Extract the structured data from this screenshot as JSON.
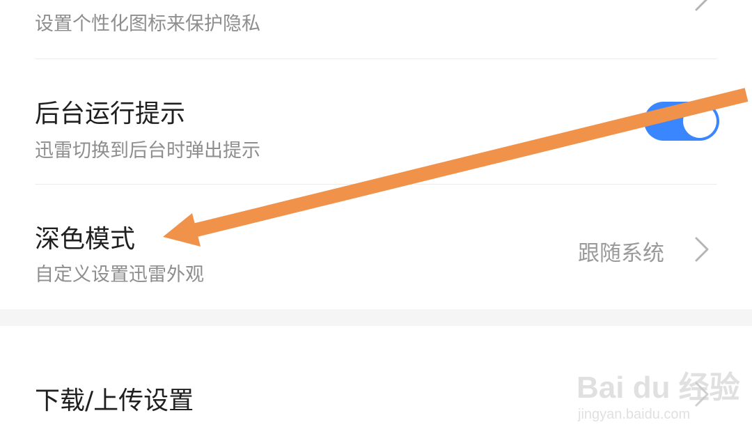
{
  "settings": {
    "privacy_icon": {
      "subtitle": "设置个性化图标来保护隐私"
    },
    "background_hint": {
      "title": "后台运行提示",
      "subtitle": "迅雷切换到后台时弹出提示",
      "toggle_on": true
    },
    "dark_mode": {
      "title": "深色模式",
      "subtitle": "自定义设置迅雷外观",
      "value": "跟随系统"
    },
    "download_upload": {
      "title": "下载/上传设置"
    }
  },
  "colors": {
    "toggle_on": "#3a86ff",
    "annotation_arrow": "#f0924a"
  },
  "watermark": {
    "brand": "Bai du 经验",
    "url": "jingyan.baidu.com"
  }
}
